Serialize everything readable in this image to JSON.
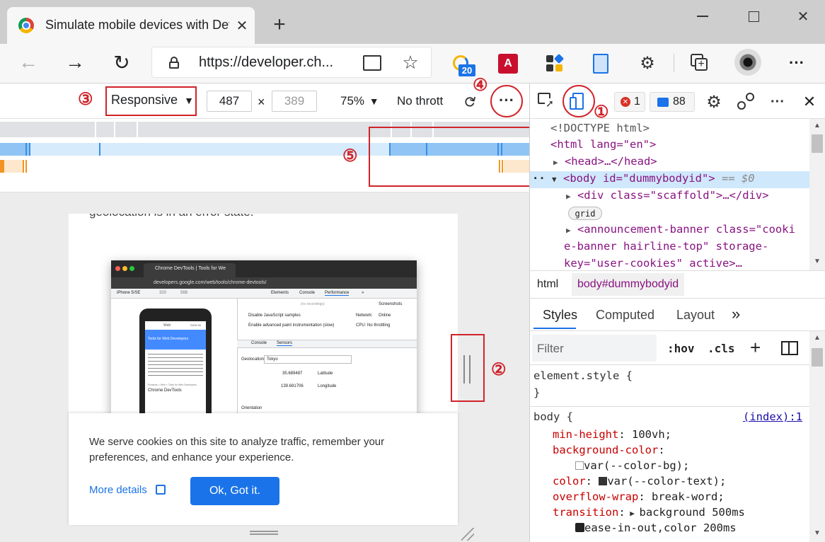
{
  "browser": {
    "tab_title": "Simulate mobile devices with Dev",
    "url": "https://developer.ch...",
    "collections_badge": "20"
  },
  "device_toolbar": {
    "dimensions_preset": "Responsive",
    "width": "487",
    "times": "×",
    "height_placeholder": "389",
    "zoom": "75%",
    "throttling": "No thrott"
  },
  "callouts": {
    "c1": "①",
    "c2": "②",
    "c3": "③",
    "c4": "④",
    "c5": "⑤"
  },
  "page": {
    "partial_text": "geolocation is in an error state.",
    "inner_screenshot": {
      "title": "Chrome DevTools | Tools for We",
      "url": "developers.google.com/web/tools/chrome-devtools/",
      "device": "iPhone 5/SE",
      "w": "320",
      "h": "568",
      "tabs": [
        "Elements",
        "Console",
        "Performance",
        "»"
      ],
      "no_recordings": "(no recordings)",
      "screenshots_label": "Screenshots",
      "disable_js": "Disable JavaScript samples",
      "advanced_paint": "Enable advanced paint instrumentation (slow)",
      "network_label": "Network:",
      "network_value": "Online",
      "cpu_label": "CPU:",
      "cpu_value": "No throttling",
      "drawer_tabs": [
        "Console",
        "Sensors"
      ],
      "geolocation_label": "Geolocation",
      "geolocation_value": "Tokyo",
      "latitude_value": "35.689487",
      "latitude_label": "Latitude",
      "longitude_value": "139.691706",
      "longitude_label": "Longitude",
      "orientation_label": "Orientation",
      "phone_banner": "Tools for Web Developers",
      "phone_crumbs": "Products > Web > Tools for Web Developers",
      "phone_heading": "Chrome DevTools",
      "phone_web": "Web",
      "phone_sign": "SIGN IN"
    },
    "cookie_text": "We serve cookies on this site to analyze traffic, remember your preferences, and enhance your experience.",
    "more_details": "More details",
    "ok_button": "Ok, Got it."
  },
  "devtools": {
    "error_count": "1",
    "message_count": "88",
    "dom": {
      "doctype": "<!DOCTYPE html>",
      "html_open": "<html lang=\"en\">",
      "head": "<head>…</head>",
      "body_open": "<body id=\"dummybodyid\">",
      "body_eq": "== $0",
      "div_scaffold": "<div class=\"scaffold\">…</div>",
      "grid_badge": "grid",
      "banner1": "<announcement-banner class=\"cooki",
      "banner2": "e-banner hairline-top\" storage-",
      "banner3": "key=\"user-cookies\" active>…"
    },
    "breadcrumbs": [
      "html",
      "body#dummybodyid"
    ],
    "tabs": [
      "Styles",
      "Computed",
      "Layout",
      "»"
    ],
    "filter_placeholder": "Filter",
    "hov": ":hov",
    "cls": ".cls",
    "plus": "+",
    "element_style": "element.style {",
    "close_brace": "}",
    "body_selector": "body {",
    "source_link": "(index):1",
    "rules": [
      {
        "prop": "min-height",
        "value": "100vh;"
      },
      {
        "prop": "background-color",
        "value": ""
      },
      {
        "prop": "",
        "value": "var(--color-bg);"
      },
      {
        "prop": "color",
        "value": "var(--color-text);"
      },
      {
        "prop": "overflow-wrap",
        "value": "break-word;"
      },
      {
        "prop": "transition",
        "value": "background 500ms"
      },
      {
        "prop": "",
        "value": "ease-in-out,color 200ms"
      }
    ]
  }
}
